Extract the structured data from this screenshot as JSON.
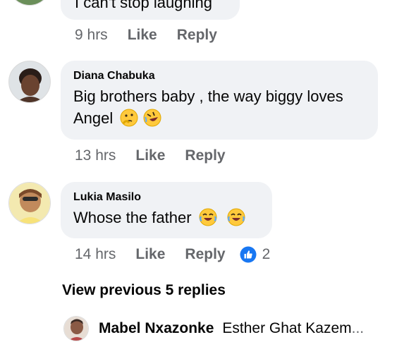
{
  "comments": [
    {
      "text": "I can't stop laughing",
      "time": "9 hrs",
      "like": "Like",
      "reply": "Reply"
    },
    {
      "author": "Diana Chabuka",
      "line1": "Big brothers baby , the way biggy loves",
      "line2": "Angel",
      "emojis": [
        "thinking-face",
        "rolling-laughing-face"
      ],
      "time": "13 hrs",
      "like": "Like",
      "reply": "Reply"
    },
    {
      "author": "Lukia Masilo",
      "text": "Whose the father",
      "emojis": [
        "tears-of-joy-face",
        "tears-of-joy-face"
      ],
      "time": "14 hrs",
      "like": "Like",
      "reply": "Reply",
      "reaction": "like",
      "reaction_count": "2"
    }
  ],
  "view_previous": "View previous 5 replies",
  "reply_preview": {
    "author": "Mabel Nxazonke",
    "snippet": "Esther Ghat Kazem",
    "ellipsis": "..."
  },
  "colors": {
    "bubble": "#f0f2f5",
    "meta": "#65676b",
    "like_blue": "#1877f2",
    "emoji_yellow": "#ffc93c"
  }
}
